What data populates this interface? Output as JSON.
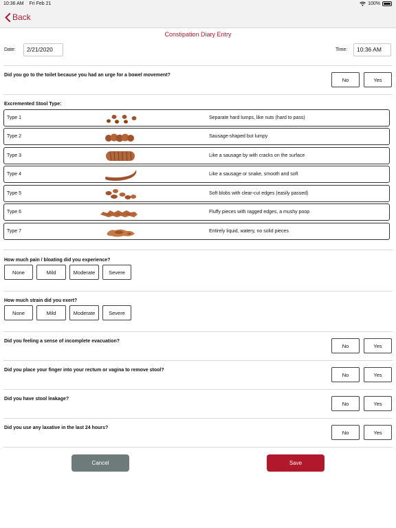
{
  "status": {
    "time": "10:36 AM",
    "date": "Fri Feb 21",
    "battery": "100%",
    "battery_level": 1.0
  },
  "nav": {
    "back_label": "Back"
  },
  "title": "Constipation Diary Entry",
  "date_label": "Date:",
  "date_value": "2/21/2020",
  "time_label": "Time:",
  "time_value": "10:36 AM",
  "q_urge": "Did you go to the toilet because you had an urge for a bowel movement?",
  "no_label": "No",
  "yes_label": "Yes",
  "stool_heading": "Excremented Stool Type:",
  "stool_types": [
    {
      "type": "Type 1",
      "desc": "Separate hard lumps, like nuts (hard to pass)"
    },
    {
      "type": "Type 2",
      "desc": "Sausage-shaped but lumpy"
    },
    {
      "type": "Type 3",
      "desc": "Like a sausage by with cracks on the surface"
    },
    {
      "type": "Type 4",
      "desc": "Like a sausage or snake, smooth and soft"
    },
    {
      "type": "Type 5",
      "desc": "Soft blobs with clear-cut edges (easily passed)"
    },
    {
      "type": "Type 6",
      "desc": "Fluffy pieces with ragged edges, a mushy poop"
    },
    {
      "type": "Type 7",
      "desc": "Entirely liquid, watery, no solid pieces"
    }
  ],
  "q_pain": "How much pain / bloating did you experience?",
  "q_strain": "How much strain did you exert?",
  "severity": [
    "None",
    "Mild",
    "Moderate",
    "Severe"
  ],
  "q_incomplete": "Did you feeling a sense of incomplete evacuation?",
  "q_finger": "Did you place your finger into your rectum or vagina to remove stool?",
  "q_leakage": "Did you have stool leakage?",
  "q_laxative": "Did you use any laxative in the last 24 hours?",
  "cancel_label": "Cancel",
  "save_label": "Save",
  "colors": {
    "accent": "#b2182b",
    "cancel": "#6e7b7b",
    "stool": "#a0522d"
  }
}
